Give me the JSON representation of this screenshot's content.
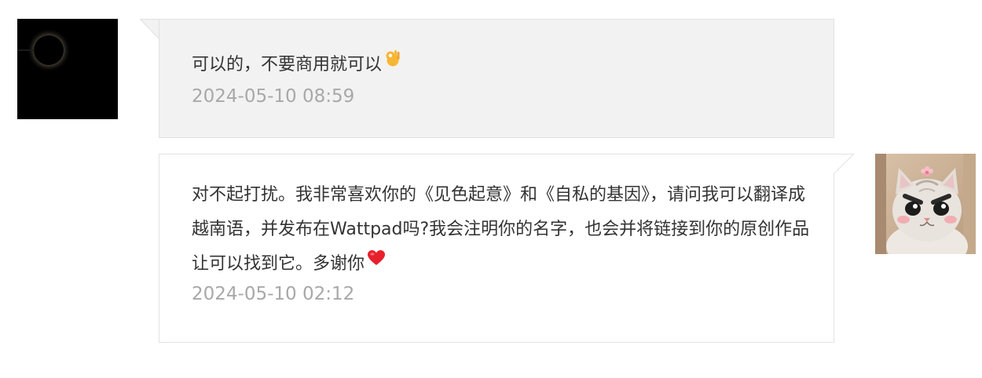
{
  "conversation": {
    "messages": [
      {
        "side": "left",
        "avatar": "eclipse-avatar",
        "text": "可以的，不要商用就可以",
        "emoji": "ok-hand-icon",
        "time": "2024-05-10 08:59"
      },
      {
        "side": "right",
        "avatar": "cat-avatar",
        "text": "对不起打扰。我非常喜欢你的《见色起意》和《自私的基因》，请问我可以翻译成越南语，并发布在Wattpad吗?我会注明你的名字，也会并将链接到你的原创作品让可以找到它。多谢你",
        "emoji": "heart-icon",
        "time": "2024-05-10 02:12"
      }
    ]
  },
  "colors": {
    "received_bubble": "#f2f2f2",
    "sent_bubble": "#ffffff",
    "bubble_border": "#e2e2e2",
    "text": "#333333",
    "timestamp": "#a8a8a8"
  }
}
